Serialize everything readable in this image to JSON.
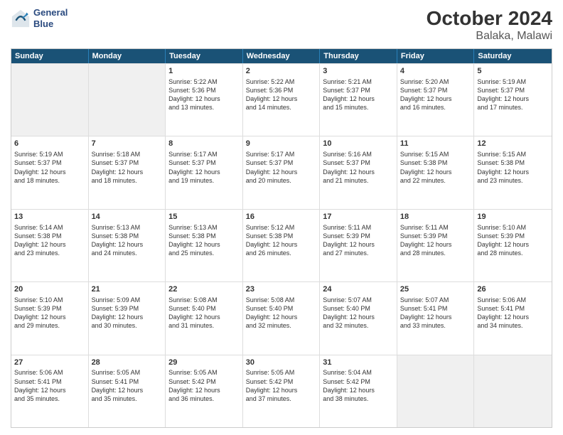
{
  "header": {
    "logo": {
      "line1": "General",
      "line2": "Blue"
    },
    "month": "October 2024",
    "location": "Balaka, Malawi"
  },
  "weekdays": [
    "Sunday",
    "Monday",
    "Tuesday",
    "Wednesday",
    "Thursday",
    "Friday",
    "Saturday"
  ],
  "weeks": [
    [
      {
        "day": "",
        "info": "",
        "shaded": true
      },
      {
        "day": "",
        "info": "",
        "shaded": true
      },
      {
        "day": "1",
        "info": "Sunrise: 5:22 AM\nSunset: 5:36 PM\nDaylight: 12 hours\nand 13 minutes."
      },
      {
        "day": "2",
        "info": "Sunrise: 5:22 AM\nSunset: 5:36 PM\nDaylight: 12 hours\nand 14 minutes."
      },
      {
        "day": "3",
        "info": "Sunrise: 5:21 AM\nSunset: 5:37 PM\nDaylight: 12 hours\nand 15 minutes."
      },
      {
        "day": "4",
        "info": "Sunrise: 5:20 AM\nSunset: 5:37 PM\nDaylight: 12 hours\nand 16 minutes."
      },
      {
        "day": "5",
        "info": "Sunrise: 5:19 AM\nSunset: 5:37 PM\nDaylight: 12 hours\nand 17 minutes."
      }
    ],
    [
      {
        "day": "6",
        "info": "Sunrise: 5:19 AM\nSunset: 5:37 PM\nDaylight: 12 hours\nand 18 minutes."
      },
      {
        "day": "7",
        "info": "Sunrise: 5:18 AM\nSunset: 5:37 PM\nDaylight: 12 hours\nand 18 minutes."
      },
      {
        "day": "8",
        "info": "Sunrise: 5:17 AM\nSunset: 5:37 PM\nDaylight: 12 hours\nand 19 minutes."
      },
      {
        "day": "9",
        "info": "Sunrise: 5:17 AM\nSunset: 5:37 PM\nDaylight: 12 hours\nand 20 minutes."
      },
      {
        "day": "10",
        "info": "Sunrise: 5:16 AM\nSunset: 5:37 PM\nDaylight: 12 hours\nand 21 minutes."
      },
      {
        "day": "11",
        "info": "Sunrise: 5:15 AM\nSunset: 5:38 PM\nDaylight: 12 hours\nand 22 minutes."
      },
      {
        "day": "12",
        "info": "Sunrise: 5:15 AM\nSunset: 5:38 PM\nDaylight: 12 hours\nand 23 minutes."
      }
    ],
    [
      {
        "day": "13",
        "info": "Sunrise: 5:14 AM\nSunset: 5:38 PM\nDaylight: 12 hours\nand 23 minutes."
      },
      {
        "day": "14",
        "info": "Sunrise: 5:13 AM\nSunset: 5:38 PM\nDaylight: 12 hours\nand 24 minutes."
      },
      {
        "day": "15",
        "info": "Sunrise: 5:13 AM\nSunset: 5:38 PM\nDaylight: 12 hours\nand 25 minutes."
      },
      {
        "day": "16",
        "info": "Sunrise: 5:12 AM\nSunset: 5:38 PM\nDaylight: 12 hours\nand 26 minutes."
      },
      {
        "day": "17",
        "info": "Sunrise: 5:11 AM\nSunset: 5:39 PM\nDaylight: 12 hours\nand 27 minutes."
      },
      {
        "day": "18",
        "info": "Sunrise: 5:11 AM\nSunset: 5:39 PM\nDaylight: 12 hours\nand 28 minutes."
      },
      {
        "day": "19",
        "info": "Sunrise: 5:10 AM\nSunset: 5:39 PM\nDaylight: 12 hours\nand 28 minutes."
      }
    ],
    [
      {
        "day": "20",
        "info": "Sunrise: 5:10 AM\nSunset: 5:39 PM\nDaylight: 12 hours\nand 29 minutes."
      },
      {
        "day": "21",
        "info": "Sunrise: 5:09 AM\nSunset: 5:39 PM\nDaylight: 12 hours\nand 30 minutes."
      },
      {
        "day": "22",
        "info": "Sunrise: 5:08 AM\nSunset: 5:40 PM\nDaylight: 12 hours\nand 31 minutes."
      },
      {
        "day": "23",
        "info": "Sunrise: 5:08 AM\nSunset: 5:40 PM\nDaylight: 12 hours\nand 32 minutes."
      },
      {
        "day": "24",
        "info": "Sunrise: 5:07 AM\nSunset: 5:40 PM\nDaylight: 12 hours\nand 32 minutes."
      },
      {
        "day": "25",
        "info": "Sunrise: 5:07 AM\nSunset: 5:41 PM\nDaylight: 12 hours\nand 33 minutes."
      },
      {
        "day": "26",
        "info": "Sunrise: 5:06 AM\nSunset: 5:41 PM\nDaylight: 12 hours\nand 34 minutes."
      }
    ],
    [
      {
        "day": "27",
        "info": "Sunrise: 5:06 AM\nSunset: 5:41 PM\nDaylight: 12 hours\nand 35 minutes."
      },
      {
        "day": "28",
        "info": "Sunrise: 5:05 AM\nSunset: 5:41 PM\nDaylight: 12 hours\nand 35 minutes."
      },
      {
        "day": "29",
        "info": "Sunrise: 5:05 AM\nSunset: 5:42 PM\nDaylight: 12 hours\nand 36 minutes."
      },
      {
        "day": "30",
        "info": "Sunrise: 5:05 AM\nSunset: 5:42 PM\nDaylight: 12 hours\nand 37 minutes."
      },
      {
        "day": "31",
        "info": "Sunrise: 5:04 AM\nSunset: 5:42 PM\nDaylight: 12 hours\nand 38 minutes."
      },
      {
        "day": "",
        "info": "",
        "shaded": true
      },
      {
        "day": "",
        "info": "",
        "shaded": true
      }
    ]
  ]
}
